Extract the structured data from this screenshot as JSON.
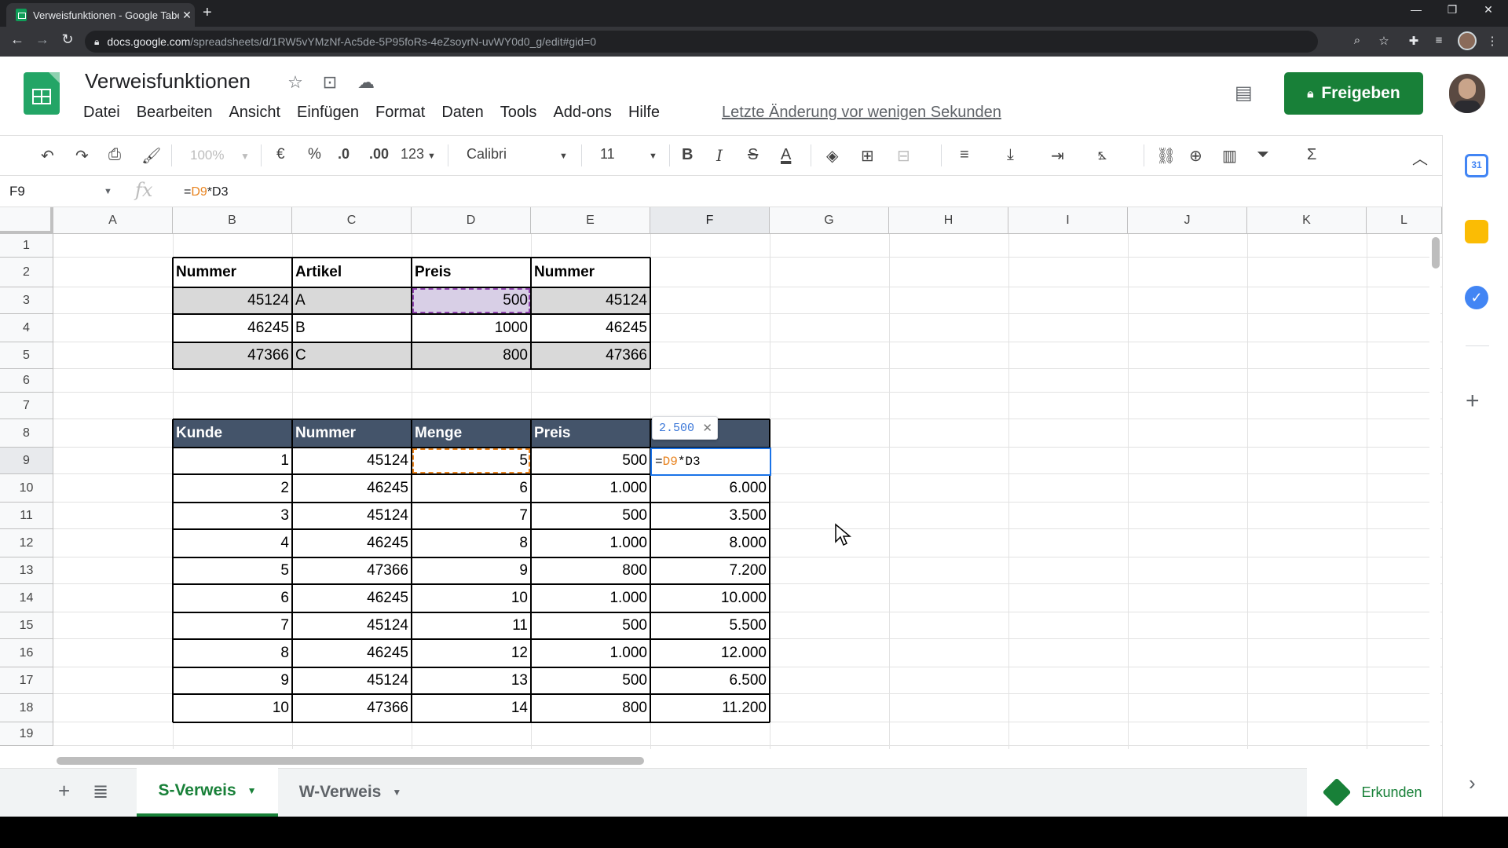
{
  "browser": {
    "tab_title": "Verweisfunktionen - Google Tabe",
    "url_host": "docs.google.com",
    "url_path": "/spreadsheets/d/1RW5vYMzNf-Ac5de-5P95foRs-4eZsoyrN-uvWY0d0_g/edit#gid=0"
  },
  "app": {
    "doc_title": "Verweisfunktionen",
    "menu": [
      "Datei",
      "Bearbeiten",
      "Ansicht",
      "Einfügen",
      "Format",
      "Daten",
      "Tools",
      "Add-ons",
      "Hilfe"
    ],
    "last_edit": "Letzte Änderung vor wenigen Sekunden",
    "share_label": "Freigeben",
    "accent": "#188038"
  },
  "toolbar": {
    "zoom": "100%",
    "currency": "€",
    "percent": "%",
    "dec_less": ".0",
    "dec_more": ".00",
    "numfmt": "123",
    "font": "Calibri",
    "size": "11"
  },
  "formula_bar": {
    "name_box": "F9",
    "fx": "fx",
    "prefix": "=",
    "ref1": "D9",
    "rest": "*D3"
  },
  "columns": [
    "A",
    "B",
    "C",
    "D",
    "E",
    "F",
    "G",
    "H",
    "I",
    "J",
    "K",
    "L"
  ],
  "rows": [
    "1",
    "2",
    "3",
    "4",
    "5",
    "6",
    "7",
    "8",
    "9",
    "10",
    "11",
    "12",
    "13",
    "14",
    "15",
    "16",
    "17",
    "18",
    "19"
  ],
  "table1": {
    "headers": [
      "Nummer",
      "Artikel",
      "Preis",
      "Nummer"
    ],
    "rows": [
      [
        "45124",
        "A",
        "500",
        "45124"
      ],
      [
        "46245",
        "B",
        "1000",
        "46245"
      ],
      [
        "47366",
        "C",
        "800",
        "47366"
      ]
    ]
  },
  "table2": {
    "headers": [
      "Kunde",
      "Nummer",
      "Menge",
      "Preis",
      ""
    ],
    "rows": [
      [
        "1",
        "45124",
        "5",
        "500",
        ""
      ],
      [
        "2",
        "46245",
        "6",
        "1.000",
        "6.000"
      ],
      [
        "3",
        "45124",
        "7",
        "500",
        "3.500"
      ],
      [
        "4",
        "46245",
        "8",
        "1.000",
        "8.000"
      ],
      [
        "5",
        "47366",
        "9",
        "800",
        "7.200"
      ],
      [
        "6",
        "46245",
        "10",
        "1.000",
        "10.000"
      ],
      [
        "7",
        "45124",
        "11",
        "500",
        "5.500"
      ],
      [
        "8",
        "46245",
        "12",
        "1.000",
        "12.000"
      ],
      [
        "9",
        "45124",
        "13",
        "500",
        "6.500"
      ],
      [
        "10",
        "47366",
        "14",
        "800",
        "11.200"
      ]
    ]
  },
  "editing": {
    "prefix": "=",
    "ref1": "D9",
    "rest": "*D3",
    "preview": "2.500"
  },
  "sheets": [
    {
      "label": "S-Verweis",
      "active": true
    },
    {
      "label": "W-Verweis",
      "active": false
    }
  ],
  "explore_label": "Erkunden"
}
